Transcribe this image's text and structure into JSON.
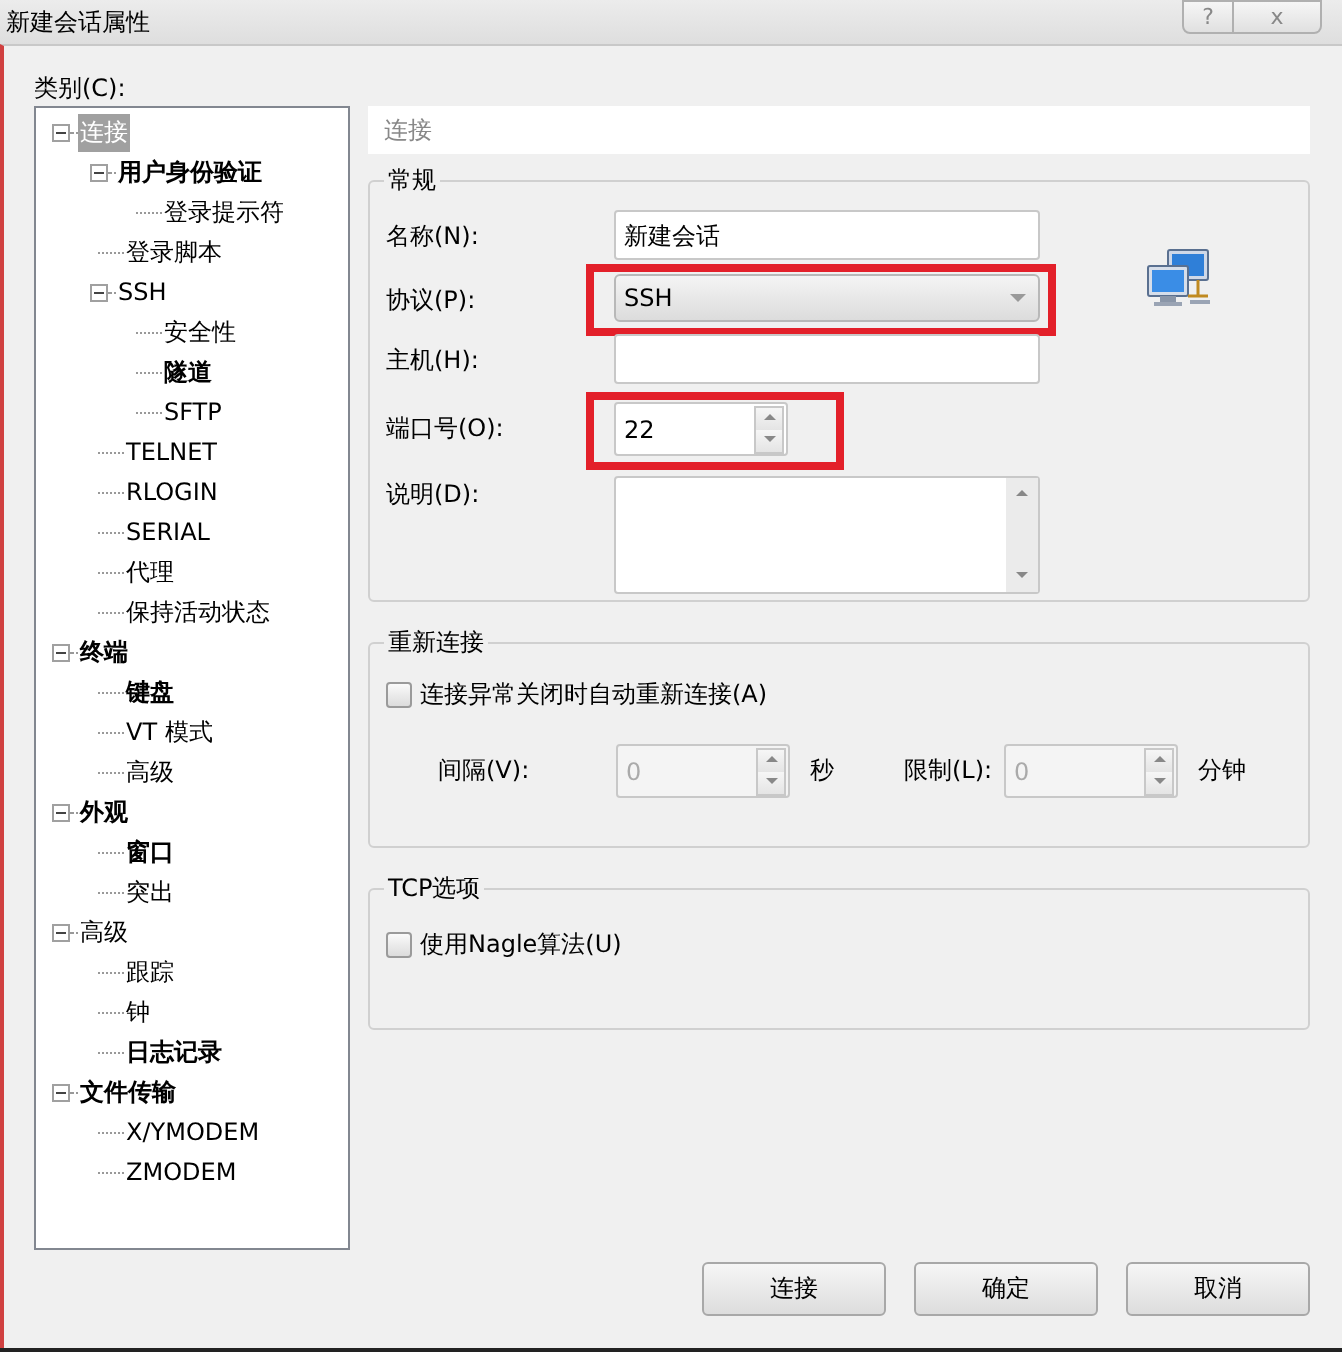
{
  "window": {
    "title": "新建会话属性",
    "buttons": [
      {
        "kind": "help",
        "label": "?"
      },
      {
        "kind": "close",
        "label": "x"
      }
    ]
  },
  "category_label": "类别(C):",
  "tree": [
    {
      "label": "连接",
      "bold": false,
      "selected": true,
      "expanded": true,
      "children": [
        {
          "label": "用户身份验证",
          "bold": true,
          "selected": false,
          "expanded": true,
          "children": [
            {
              "label": "登录提示符",
              "bold": false,
              "selected": false
            }
          ]
        },
        {
          "label": "登录脚本",
          "bold": false,
          "selected": false
        },
        {
          "label": "SSH",
          "bold": false,
          "selected": false,
          "expanded": true,
          "children": [
            {
              "label": "安全性",
              "bold": false,
              "selected": false
            },
            {
              "label": "隧道",
              "bold": true,
              "selected": false
            },
            {
              "label": "SFTP",
              "bold": false,
              "selected": false
            }
          ]
        },
        {
          "label": "TELNET",
          "bold": false,
          "selected": false
        },
        {
          "label": "RLOGIN",
          "bold": false,
          "selected": false
        },
        {
          "label": "SERIAL",
          "bold": false,
          "selected": false
        },
        {
          "label": "代理",
          "bold": false,
          "selected": false
        },
        {
          "label": "保持活动状态",
          "bold": false,
          "selected": false
        }
      ]
    },
    {
      "label": "终端",
      "bold": true,
      "selected": false,
      "expanded": true,
      "children": [
        {
          "label": "键盘",
          "bold": true,
          "selected": false
        },
        {
          "label": "VT 模式",
          "bold": false,
          "selected": false
        },
        {
          "label": "高级",
          "bold": false,
          "selected": false
        }
      ]
    },
    {
      "label": "外观",
      "bold": true,
      "selected": false,
      "expanded": true,
      "children": [
        {
          "label": "窗口",
          "bold": true,
          "selected": false
        },
        {
          "label": "突出",
          "bold": false,
          "selected": false
        }
      ]
    },
    {
      "label": "高级",
      "bold": false,
      "selected": false,
      "expanded": true,
      "children": [
        {
          "label": "跟踪",
          "bold": false,
          "selected": false
        },
        {
          "label": "钟",
          "bold": false,
          "selected": false
        },
        {
          "label": "日志记录",
          "bold": true,
          "selected": false
        }
      ]
    },
    {
      "label": "文件传输",
      "bold": true,
      "selected": false,
      "expanded": true,
      "children": [
        {
          "label": "X/YMODEM",
          "bold": false,
          "selected": false
        },
        {
          "label": "ZMODEM",
          "bold": false,
          "selected": false
        }
      ]
    }
  ],
  "page_title": "连接",
  "general": {
    "title": "常规",
    "fields": [
      {
        "kind": "text",
        "label": "名称(N):",
        "value": "新建会话",
        "highlighted": false
      },
      {
        "kind": "combo",
        "label": "协议(P):",
        "value": "SSH",
        "highlighted": true
      },
      {
        "kind": "text",
        "label": "主机(H):",
        "highlighted": false
      },
      {
        "kind": "spin",
        "label": "端口号(O):",
        "value": "22",
        "highlighted": true
      },
      {
        "kind": "textarea",
        "label": "说明(D):",
        "highlighted": false
      }
    ]
  },
  "reconnect": {
    "title": "重新连接",
    "checkbox": {
      "label": "连接异常关闭时自动重新连接(A)",
      "checked": false
    },
    "spins": [
      {
        "label": "间隔(V):",
        "value": "0",
        "unit": "秒",
        "disabled": true
      },
      {
        "label": "限制(L):",
        "value": "0",
        "unit": "分钟",
        "disabled": true
      }
    ]
  },
  "tcp": {
    "title": "TCP选项",
    "checkbox": {
      "label": "使用Nagle算法(U)",
      "checked": false
    }
  },
  "buttons": [
    "连接",
    "确定",
    "取消"
  ]
}
